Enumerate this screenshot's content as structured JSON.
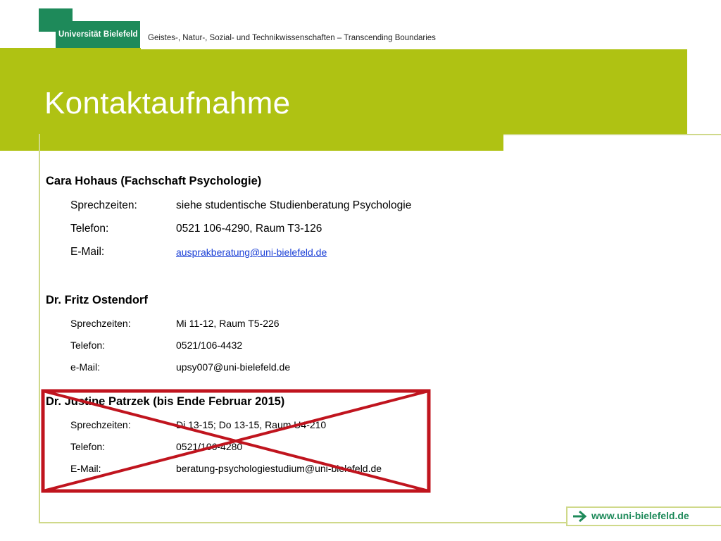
{
  "header": {
    "logo_text": "Universität Bielefeld",
    "tagline": "Geistes-, Natur-, Sozial- und Technikwissenschaften – Transcending Boundaries",
    "title": "Kontaktaufnahme"
  },
  "colors": {
    "accent_green": "#afc213",
    "brand_green": "#1e8a5a",
    "cross_red": "#c0141e",
    "link_blue": "#1a3fd6"
  },
  "contacts": [
    {
      "name": "Cara Hohaus (Fachschaft Psychologie)",
      "rows": [
        {
          "label": "Sprechzeiten:",
          "value": "siehe studentische Studienberatung Psychologie"
        },
        {
          "label": "Telefon:",
          "value": "0521 106-4290, Raum T3-126"
        },
        {
          "label": "E-Mail:",
          "value": "ausprakberatung@uni-bielefeld.de"
        }
      ]
    },
    {
      "name": "Dr. Fritz Ostendorf",
      "rows": [
        {
          "label": "Sprechzeiten:",
          "value": "Mi 11-12, Raum T5-226"
        },
        {
          "label": "Telefon:",
          "value": "0521/106-4432"
        },
        {
          "label": "e-Mail:",
          "value": "upsy007@uni-bielefeld.de"
        }
      ]
    },
    {
      "name": "Dr. Justine Patrzek (bis Ende Februar 2015)",
      "rows": [
        {
          "label": "Sprechzeiten:",
          "value": "Di 13-15; Do 13-15, Raum U4-210"
        },
        {
          "label": "Telefon:",
          "value": "0521/106-4280"
        },
        {
          "label": "E-Mail:",
          "value": "beratung-psychologiestudium@uni-bielefeld.de"
        }
      ]
    }
  ],
  "footer": {
    "url": "www.uni-bielefeld.de",
    "arrow_icon": "arrow-right-icon"
  }
}
